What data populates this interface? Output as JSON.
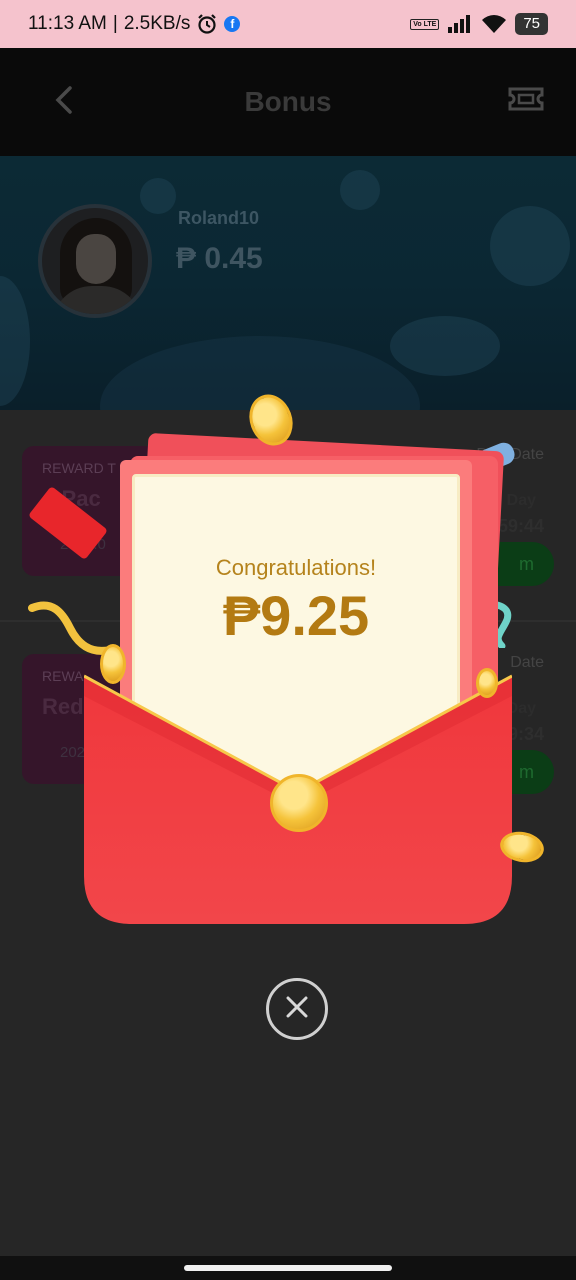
{
  "status_bar": {
    "time": "11:13 AM",
    "network_speed": "2.5KB/s",
    "separator": "|",
    "alarm_icon": "alarm-icon",
    "facebook_icon": "f",
    "volte": "Vo LTE",
    "battery": "75"
  },
  "header": {
    "title": "Bonus",
    "back_icon": "chevron-left-icon",
    "ticket_icon": "ticket-icon"
  },
  "profile": {
    "username": "Roland10",
    "balance": "₱ 0.45"
  },
  "rewards": [
    {
      "type_label": "REWARD T",
      "name": "d Pac",
      "date": "2024.0",
      "due_label": "Due Date",
      "due_day": "Day",
      "due_time": "259:44",
      "claim_label": "m"
    },
    {
      "type_label": "REWA",
      "name": "Red",
      "date": "202",
      "due_label": "Date",
      "due_day": "Day",
      "due_time": "9:34",
      "claim_label": "m"
    }
  ],
  "popup": {
    "congrats": "Congratulations!",
    "amount": "₱9.25",
    "close_icon": "close-circle-icon"
  },
  "colors": {
    "status_bar_bg": "#f5c3cd",
    "envelope_red": "#f23a3e",
    "letter_cream": "#fdf8e2",
    "amount_gold": "#b37a12",
    "coin_gold": "#f5c33a"
  }
}
